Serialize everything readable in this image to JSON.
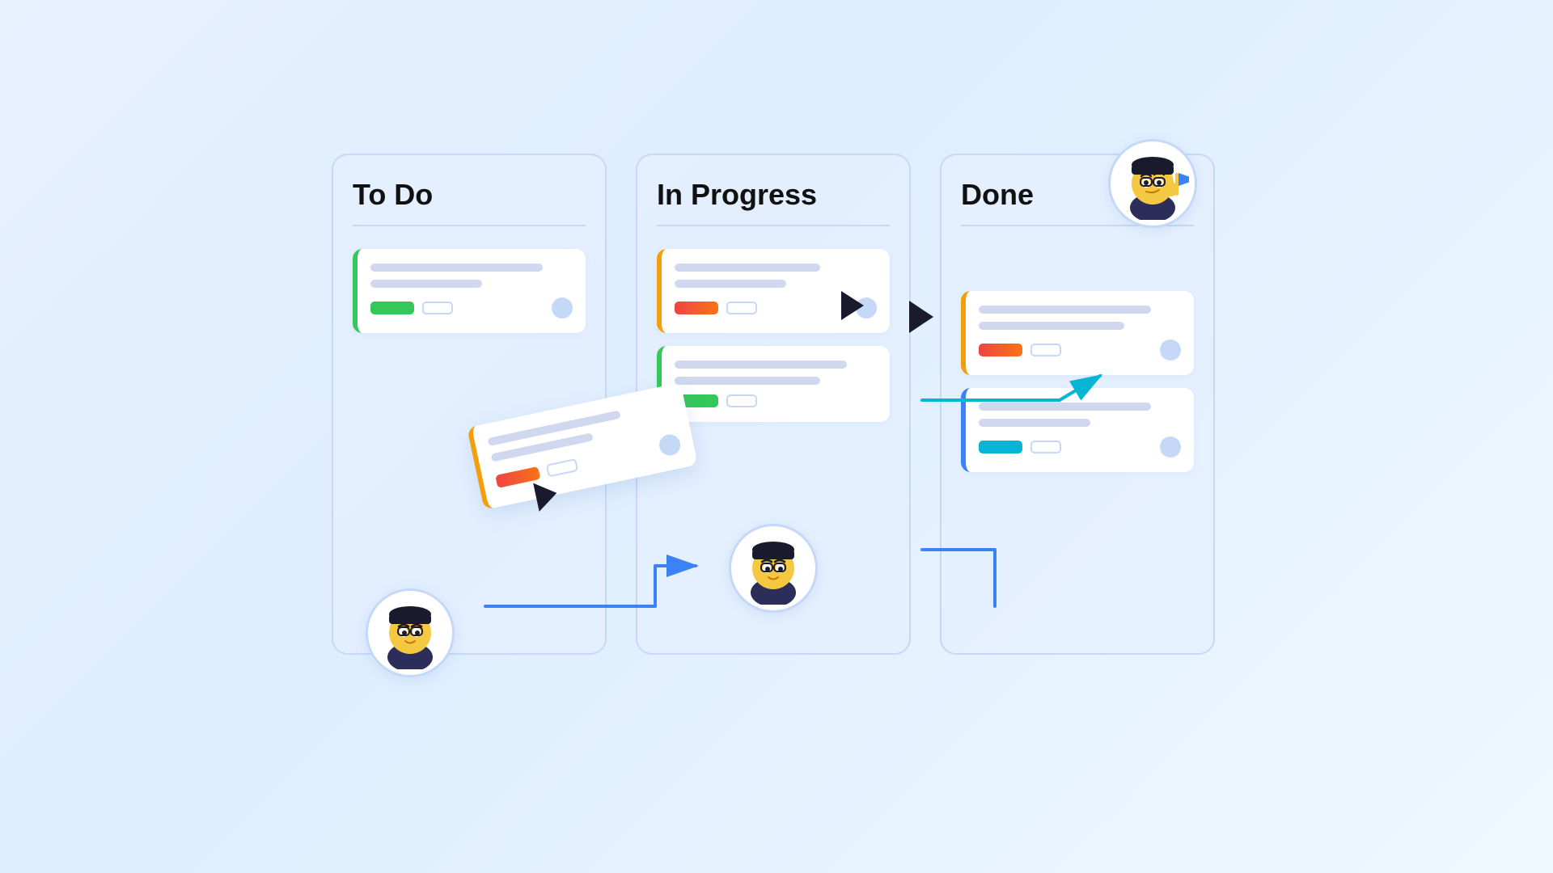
{
  "board": {
    "columns": [
      {
        "id": "todo",
        "title": "To Do",
        "border_color": "#c5d8f8",
        "cards": [
          {
            "id": "todo-1",
            "border": "green",
            "lines": [
              "long",
              "short"
            ],
            "badge_color": "green",
            "show_dot": true
          }
        ]
      },
      {
        "id": "inprogress",
        "title": "In Progress",
        "border_color": "#c5d8f8",
        "cards": [
          {
            "id": "ip-1",
            "border": "orange",
            "lines": [
              "medium",
              "short"
            ],
            "badge_color": "red-orange",
            "show_dot": true
          },
          {
            "id": "ip-2",
            "border": "green",
            "lines": [
              "long",
              "medium"
            ],
            "badge_color": "green",
            "show_dot": false
          }
        ]
      },
      {
        "id": "done",
        "title": "Done",
        "border_color": "#c5d8f8",
        "cards": [
          {
            "id": "done-1",
            "border": "orange",
            "lines": [
              "long",
              "medium"
            ],
            "badge_color": "red-orange",
            "show_dot": true
          },
          {
            "id": "done-2",
            "border": "blue",
            "lines": [
              "long",
              "short"
            ],
            "badge_color": "cyan",
            "show_dot": true
          }
        ]
      }
    ]
  },
  "dragging_card": {
    "badge_color": "red-orange",
    "border": "orange"
  },
  "avatars": {
    "todo": {
      "label": "todo-avatar"
    },
    "inprogress": {
      "label": "inprogress-avatar"
    },
    "done": {
      "label": "done-avatar"
    }
  },
  "arrows": {
    "todo_to_inprogress": {
      "color": "#3b82f6"
    },
    "inprogress_to_done": {
      "color": "#06b6d4"
    }
  }
}
